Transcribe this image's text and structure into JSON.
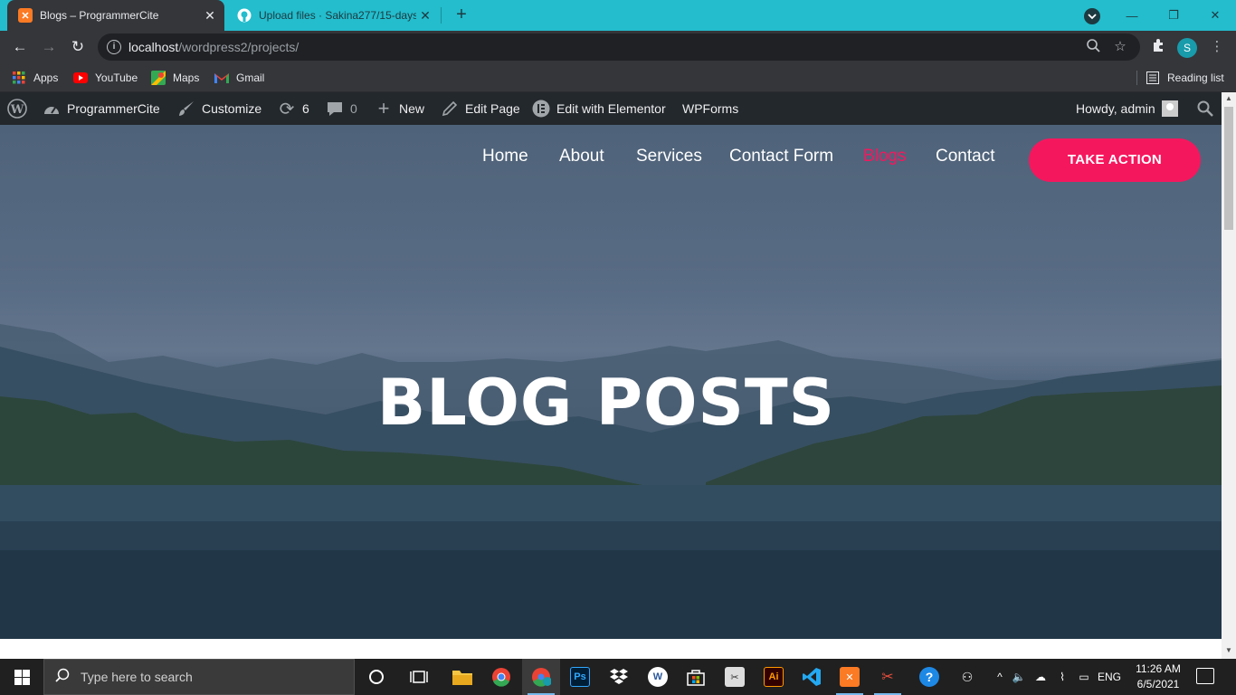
{
  "browser": {
    "tabs": [
      {
        "title": "Blogs – ProgrammerCite",
        "close": "✕",
        "active": true
      },
      {
        "title": "Upload files · Sakina277/15-days",
        "close": "✕",
        "active": false
      }
    ],
    "new_tab": "+",
    "window_controls": {
      "minimize": "—",
      "restore": "❐",
      "close": "✕"
    },
    "url_host": "localhost",
    "url_path": "/wordpress2/projects/",
    "profile_initial": "S",
    "bookmarks": [
      {
        "label": "Apps",
        "icon": "apps-grid-icon"
      },
      {
        "label": "YouTube",
        "icon": "youtube-icon"
      },
      {
        "label": "Maps",
        "icon": "maps-icon"
      },
      {
        "label": "Gmail",
        "icon": "gmail-icon"
      }
    ],
    "reading_list": "Reading list"
  },
  "admin_bar": {
    "site_name": "ProgrammerCite",
    "customize": "Customize",
    "updates_count": "6",
    "comments_count": "0",
    "new": "New",
    "edit_page": "Edit Page",
    "edit_elementor": "Edit with Elementor",
    "wpforms": "WPForms",
    "greeting": "Howdy, admin"
  },
  "site_nav": {
    "items": [
      "Home",
      "About",
      "Services",
      "Contact Form",
      "Blogs",
      "Contact"
    ],
    "active": "Blogs",
    "cta": "TAKE ACTION"
  },
  "hero": {
    "title": "BLOG POSTS"
  },
  "taskbar": {
    "search_placeholder": "Type here to search",
    "language": "ENG",
    "time": "11:26 AM",
    "date": "6/5/2021"
  },
  "colors": {
    "tab_strip": "#23bdcd",
    "chrome_dark": "#35363a",
    "admin_bar": "#23282d",
    "accent": "#f5175e",
    "taskbar": "#202020"
  }
}
